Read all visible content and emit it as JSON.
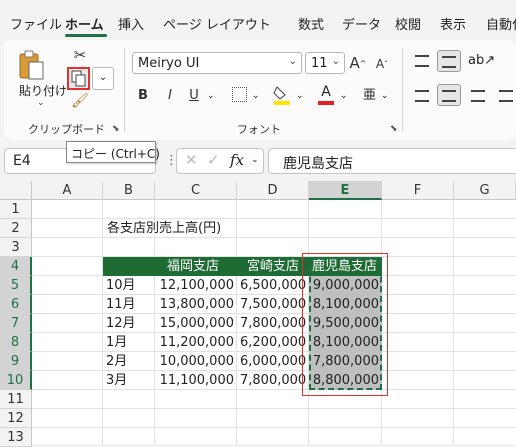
{
  "tabs": [
    "ファイル",
    "ホーム",
    "挿入",
    "ページ レイアウト",
    "数式",
    "データ",
    "校閲",
    "表示",
    "自動化"
  ],
  "active_tab": "ホーム",
  "ribbon": {
    "clipboard": {
      "paste_label": "貼り付け",
      "group_label": "クリップボード"
    },
    "font": {
      "font_name": "Meiryo UI",
      "font_size": "11",
      "bold": "B",
      "italic": "I",
      "underline": "U",
      "grow": "A",
      "shrink": "A",
      "group_label": "フォント"
    }
  },
  "tooltip": "コピー (Ctrl+C)",
  "formula_bar": {
    "name_box": "E4",
    "fx": "fx",
    "formula": "鹿児島支店"
  },
  "columns": [
    "A",
    "B",
    "C",
    "D",
    "E",
    "F",
    "G"
  ],
  "selected_column": "E",
  "rows": [
    "1",
    "2",
    "3",
    "4",
    "5",
    "6",
    "7",
    "8",
    "9",
    "10",
    "11",
    "12",
    "13"
  ],
  "sheet": {
    "title": "各支店別売上高(円)",
    "headers": [
      "福岡支店",
      "宮崎支店",
      "鹿児島支店"
    ],
    "data": [
      {
        "month": "10月",
        "fukuoka": "12,100,000",
        "miyazaki": "6,500,000",
        "kagoshima": "9,000,000"
      },
      {
        "month": "11月",
        "fukuoka": "13,800,000",
        "miyazaki": "7,500,000",
        "kagoshima": "8,100,000"
      },
      {
        "month": "12月",
        "fukuoka": "15,000,000",
        "miyazaki": "7,800,000",
        "kagoshima": "9,500,000"
      },
      {
        "month": "1月",
        "fukuoka": "11,200,000",
        "miyazaki": "6,200,000",
        "kagoshima": "8,100,000"
      },
      {
        "month": "2月",
        "fukuoka": "10,000,000",
        "miyazaki": "6,000,000",
        "kagoshima": "7,800,000"
      },
      {
        "month": "3月",
        "fukuoka": "11,100,000",
        "miyazaki": "7,800,000",
        "kagoshima": "8,800,000"
      }
    ]
  },
  "colors": {
    "accent": "#1e7145",
    "header_fill": "#1e6b33",
    "highlight": "#e03030"
  }
}
